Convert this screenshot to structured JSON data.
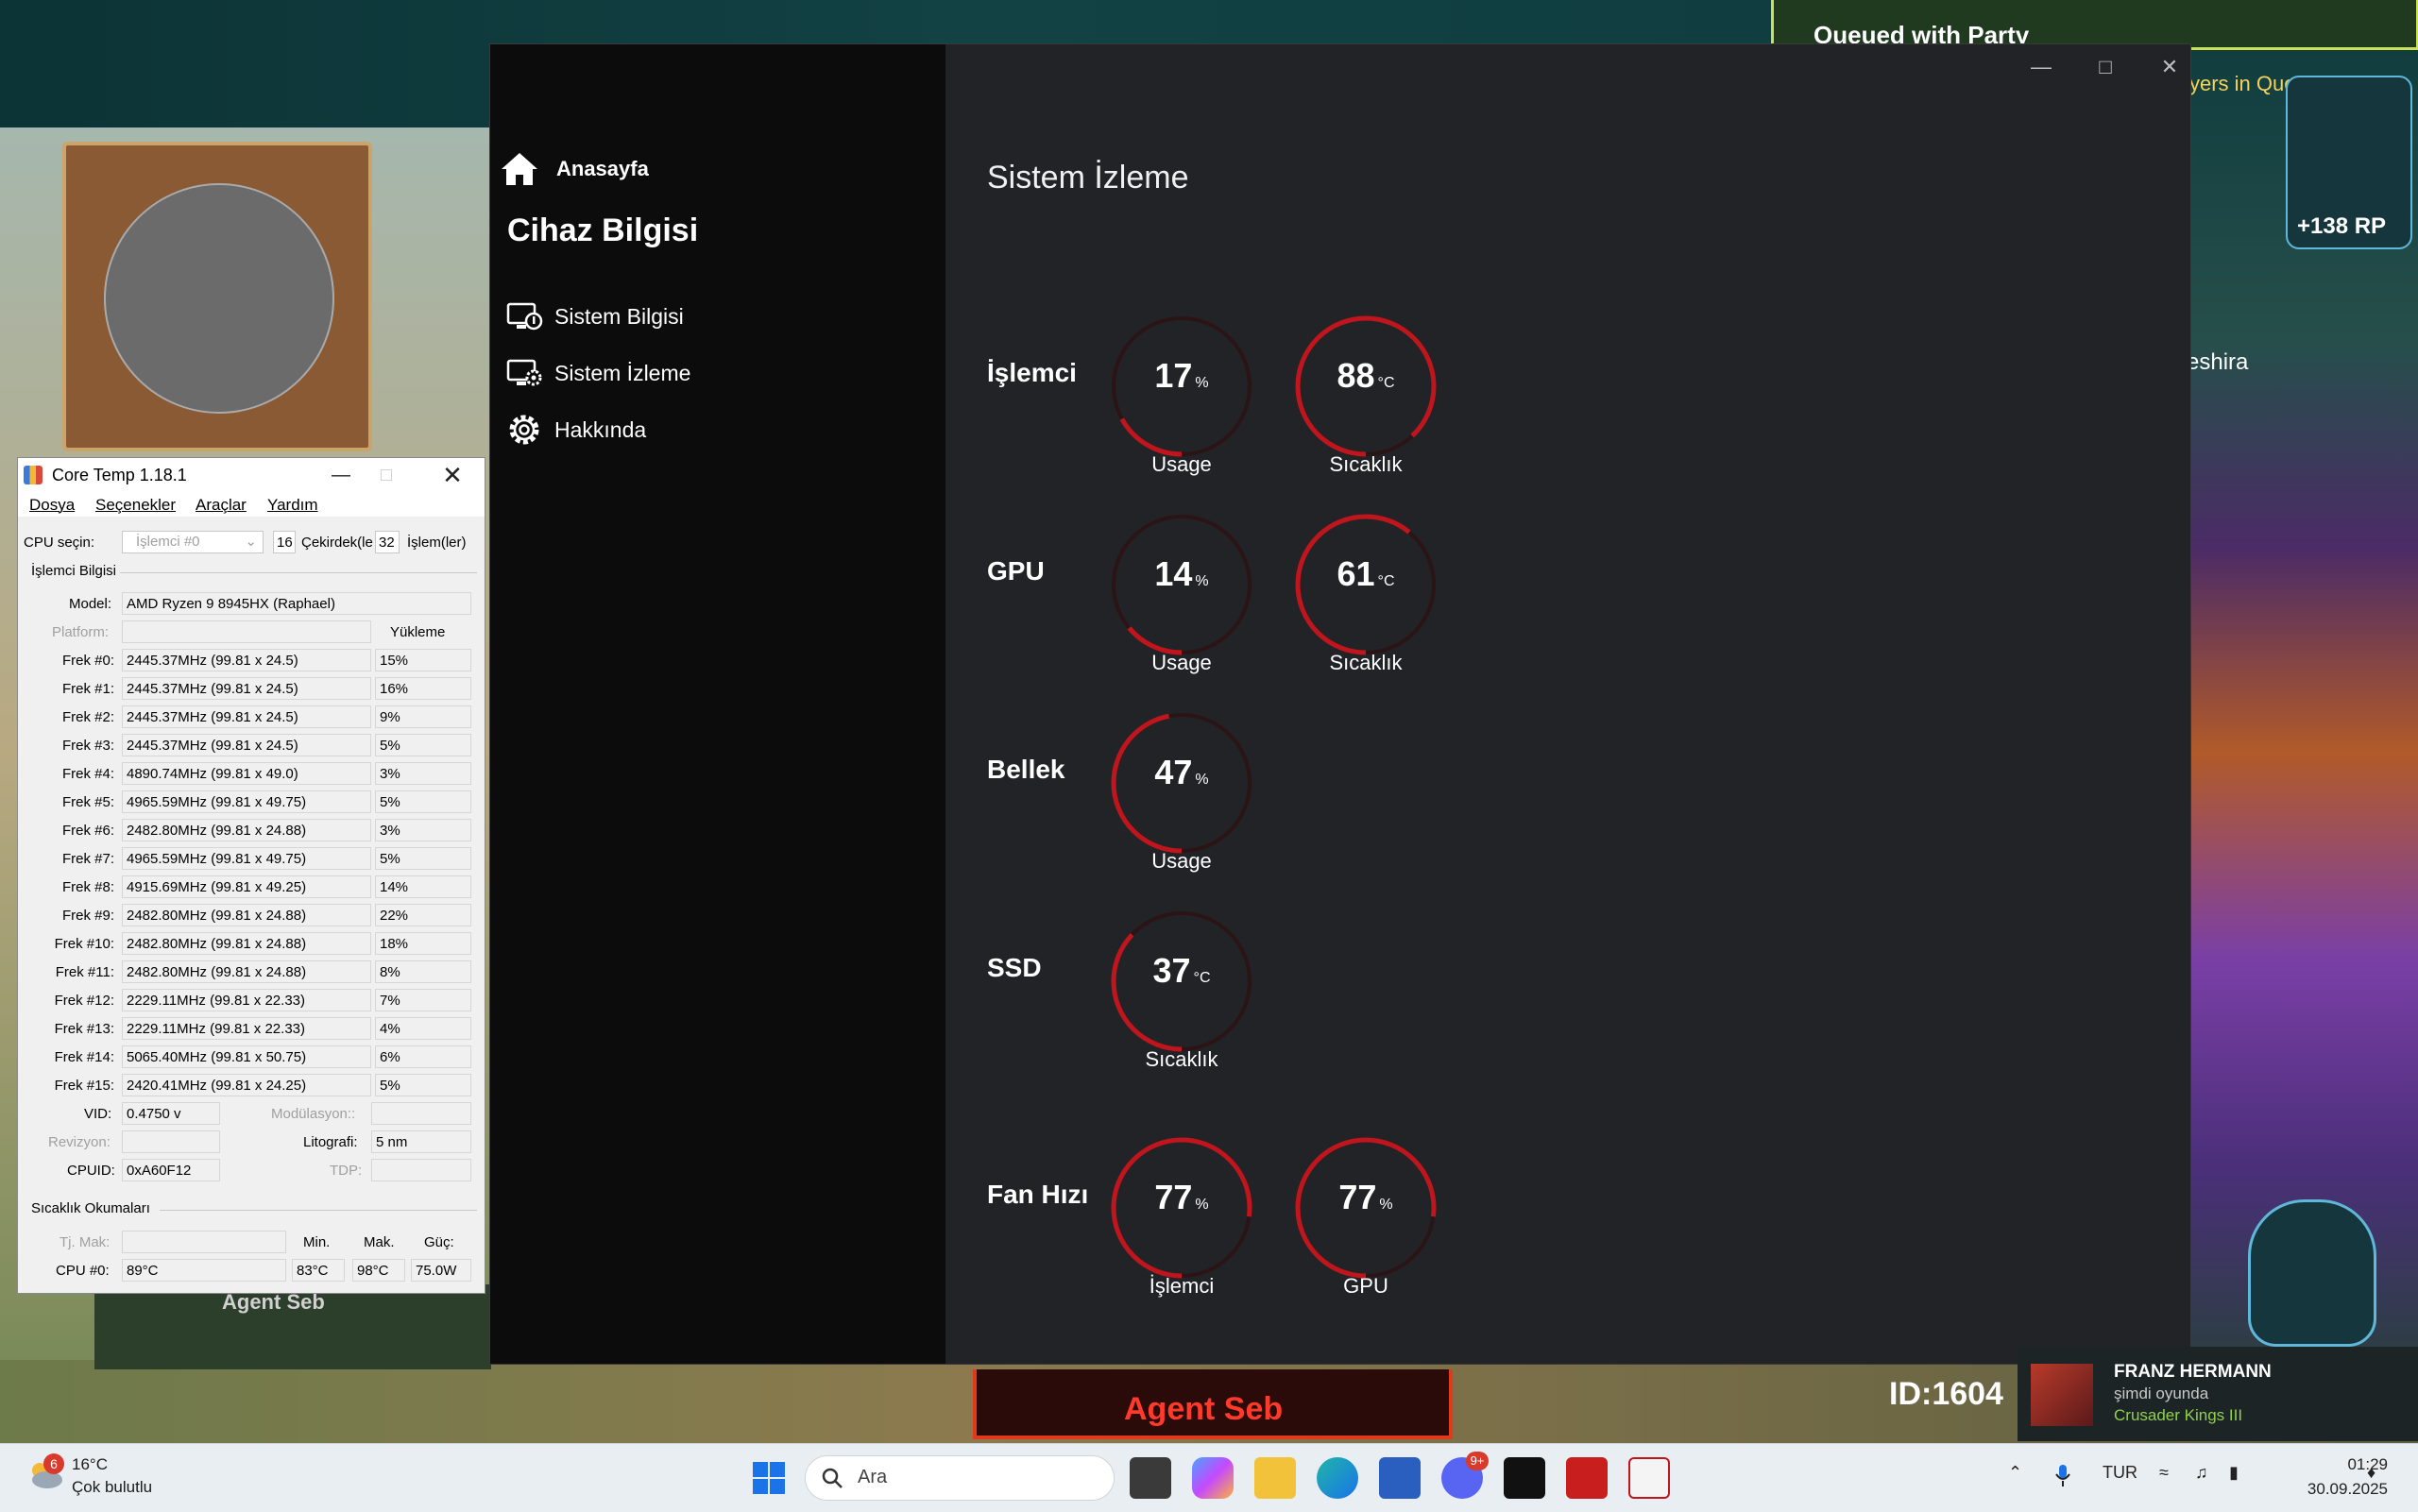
{
  "game": {
    "queued": "Queued with Party",
    "queue_sub": "yers in Queue",
    "rp": "+138 RP",
    "player_side_name": "eshira",
    "player_name": "Agent Seb",
    "bottom_name": "Agent Seb",
    "id": "ID:1604"
  },
  "coretemp": {
    "title": "Core Temp 1.18.1",
    "menu": [
      "Dosya",
      "Seçenekler",
      "Araçlar",
      "Yardım"
    ],
    "cpu_select_label": "CPU seçin:",
    "cpu_select_value": "İşlemci #0",
    "cores_count": "16",
    "cores_label": "Çekirdek(le",
    "threads_count": "32",
    "threads_label": "İşlem(ler)",
    "group_processor": "İşlemci Bilgisi",
    "model_label": "Model:",
    "model_value": "AMD Ryzen 9 8945HX (Raphael)",
    "platform_label": "Platform:",
    "load_header": "Yükleme",
    "freqs": [
      {
        "label": "Frek #0:",
        "value": "2445.37MHz (99.81 x 24.5)",
        "load": "15%"
      },
      {
        "label": "Frek #1:",
        "value": "2445.37MHz (99.81 x 24.5)",
        "load": "16%"
      },
      {
        "label": "Frek #2:",
        "value": "2445.37MHz (99.81 x 24.5)",
        "load": "9%"
      },
      {
        "label": "Frek #3:",
        "value": "2445.37MHz (99.81 x 24.5)",
        "load": "5%"
      },
      {
        "label": "Frek #4:",
        "value": "4890.74MHz (99.81 x 49.0)",
        "load": "3%"
      },
      {
        "label": "Frek #5:",
        "value": "4965.59MHz (99.81 x 49.75)",
        "load": "5%"
      },
      {
        "label": "Frek #6:",
        "value": "2482.80MHz (99.81 x 24.88)",
        "load": "3%"
      },
      {
        "label": "Frek #7:",
        "value": "4965.59MHz (99.81 x 49.75)",
        "load": "5%"
      },
      {
        "label": "Frek #8:",
        "value": "4915.69MHz (99.81 x 49.25)",
        "load": "14%"
      },
      {
        "label": "Frek #9:",
        "value": "2482.80MHz (99.81 x 24.88)",
        "load": "22%"
      },
      {
        "label": "Frek #10:",
        "value": "2482.80MHz (99.81 x 24.88)",
        "load": "18%"
      },
      {
        "label": "Frek #11:",
        "value": "2482.80MHz (99.81 x 24.88)",
        "load": "8%"
      },
      {
        "label": "Frek #12:",
        "value": "2229.11MHz (99.81 x 22.33)",
        "load": "7%"
      },
      {
        "label": "Frek #13:",
        "value": "2229.11MHz (99.81 x 22.33)",
        "load": "4%"
      },
      {
        "label": "Frek #14:",
        "value": "5065.40MHz (99.81 x 50.75)",
        "load": "6%"
      },
      {
        "label": "Frek #15:",
        "value": "2420.41MHz (99.81 x 24.25)",
        "load": "5%"
      }
    ],
    "vid_label": "VID:",
    "vid_value": "0.4750 v",
    "modulation_label": "Modülasyon::",
    "revision_label": "Revizyon:",
    "litho_label": "Litografi:",
    "litho_value": "5 nm",
    "cpuid_label": "CPUID:",
    "cpuid_value": "0xA60F12",
    "tdp_label": "TDP:",
    "group_temp": "Sıcaklık Okumaları",
    "tjmax_label": "Tj. Mak:",
    "min_header": "Min.",
    "max_header": "Mak.",
    "power_header": "Güç:",
    "cpu0_label": "CPU #0:",
    "cpu0_temp": "89°C",
    "cpu0_min": "83°C",
    "cpu0_max": "98°C",
    "cpu0_power": "75.0W"
  },
  "app": {
    "nav_home": "Anasayfa",
    "section_title": "Cihaz Bilgisi",
    "nav_items": [
      "Sistem Bilgisi",
      "Sistem İzleme",
      "Hakkında"
    ],
    "page_title": "Sistem İzleme",
    "accent_color": "#c0151c",
    "rows": [
      {
        "label": "İşlemci",
        "gauges": [
          {
            "value": "17",
            "unit": "%",
            "label": "Usage",
            "level": 17
          },
          {
            "value": "88",
            "unit": "°C",
            "label": "Sıcaklık",
            "level": 88
          }
        ]
      },
      {
        "label": "GPU",
        "gauges": [
          {
            "value": "14",
            "unit": "%",
            "label": "Usage",
            "level": 14
          },
          {
            "value": "61",
            "unit": "°C",
            "label": "Sıcaklık",
            "level": 61
          }
        ]
      },
      {
        "label": "Bellek",
        "gauges": [
          {
            "value": "47",
            "unit": "%",
            "label": "Usage",
            "level": 47
          }
        ]
      },
      {
        "label": "SSD",
        "gauges": [
          {
            "value": "37",
            "unit": "°C",
            "label": "Sıcaklık",
            "level": 37
          }
        ]
      },
      {
        "label": "Fan Hızı",
        "gauges": [
          {
            "value": "77",
            "unit": "%",
            "label": "İşlemci",
            "level": 77
          },
          {
            "value": "77",
            "unit": "%",
            "label": "GPU",
            "level": 77
          }
        ]
      }
    ]
  },
  "notification": {
    "name": "FRANZ HERMANN",
    "status": "şimdi oyunda",
    "game": "Crusader Kings III"
  },
  "taskbar": {
    "weather_badge": "6",
    "weather_temp": "16°C",
    "weather_cond": "Çok bulutlu",
    "search_placeholder": "Ara",
    "discord_badge": "9+",
    "lang": "TUR",
    "time": "01:29",
    "date": "30.09.2025"
  }
}
